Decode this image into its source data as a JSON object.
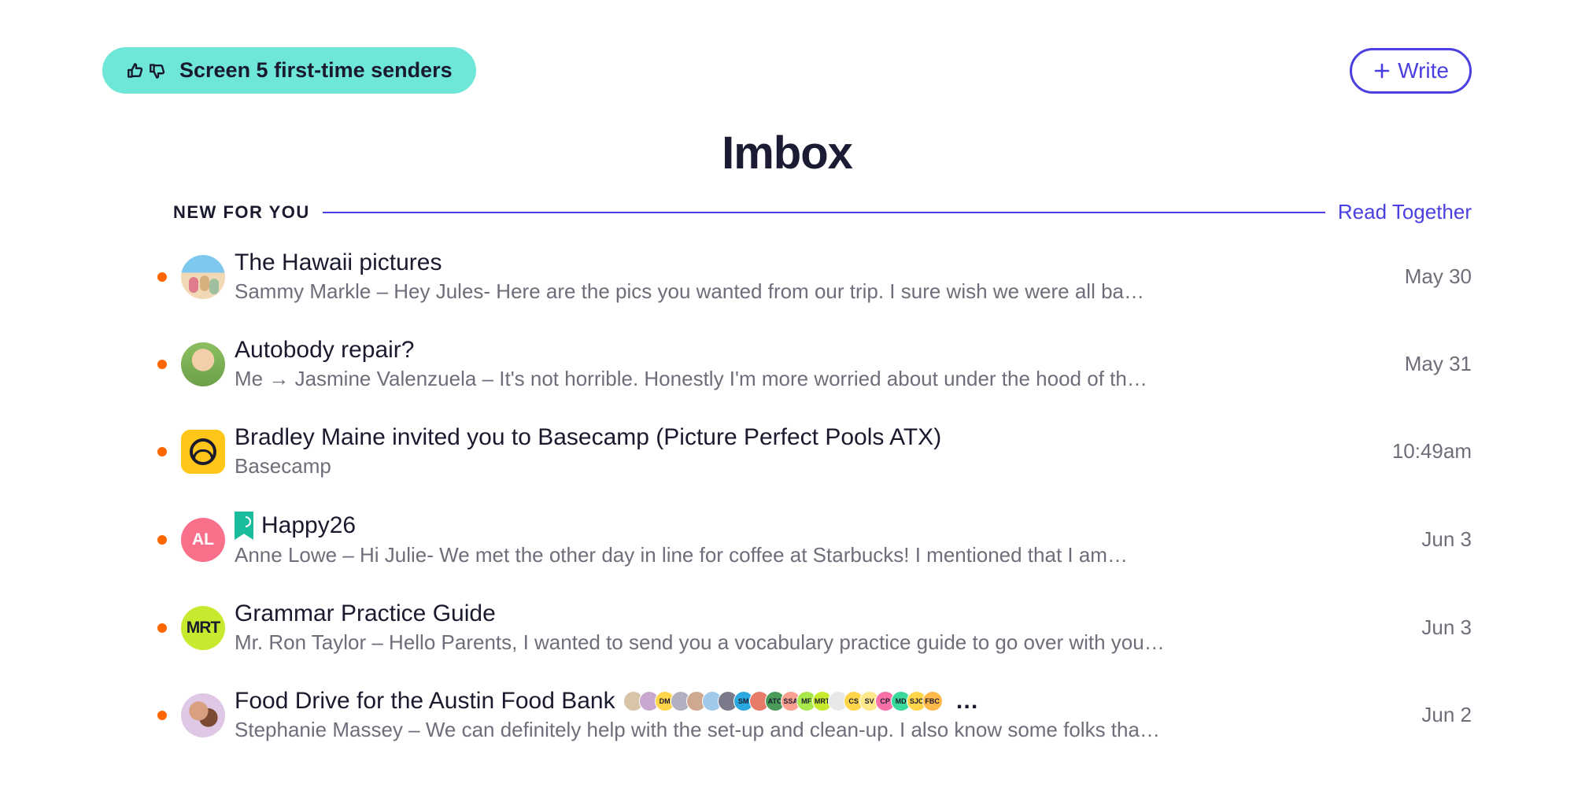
{
  "header": {
    "screener_label": "Screen 5 first-time senders",
    "write_label": "Write"
  },
  "title": "Imbox",
  "section": {
    "label": "NEW FOR YOU",
    "read_together": "Read Together"
  },
  "emails": [
    {
      "subject": "The Hawaii pictures",
      "sender_prefix": "Sammy Markle – ",
      "preview": "Hey Jules- Here are the pics you wanted from our trip. I sure wish we were all ba…",
      "date": "May 30",
      "avatar_type": "photo",
      "avatar_text": "",
      "has_bookmark": false,
      "has_thread_avatars": false
    },
    {
      "subject": "Autobody repair?",
      "sender_prefix": "Me → Jasmine Valenzuela – ",
      "preview": "It's not horrible. Honestly I'm more worried about under the hood of th…",
      "date": "May 31",
      "avatar_type": "photo",
      "avatar_text": "",
      "has_bookmark": false,
      "has_thread_avatars": false
    },
    {
      "subject": "Bradley Maine invited you to Basecamp (Picture Perfect Pools ATX)",
      "sender_prefix": "",
      "preview": "Basecamp",
      "date": "10:49am",
      "avatar_type": "basecamp",
      "avatar_text": "",
      "has_bookmark": false,
      "has_thread_avatars": false
    },
    {
      "subject": "Happy26",
      "sender_prefix": "Anne Lowe – ",
      "preview": "Hi Julie- We met the other day in line for coffee at Starbucks! I mentioned that I am…",
      "date": "Jun 3",
      "avatar_type": "initials",
      "avatar_text": "AL",
      "has_bookmark": true,
      "has_thread_avatars": false
    },
    {
      "subject": "Grammar Practice Guide",
      "sender_prefix": "Mr. Ron Taylor – ",
      "preview": "Hello Parents, I wanted to send you a vocabulary practice guide to go over with you…",
      "date": "Jun 3",
      "avatar_type": "initials",
      "avatar_text": "MRT",
      "has_bookmark": false,
      "has_thread_avatars": false
    },
    {
      "subject": "Food Drive for the Austin Food Bank",
      "sender_prefix": "Stephanie Massey – ",
      "preview": "We can definitely help with the set-up and clean-up. I also know some folks tha…",
      "date": "Jun 2",
      "avatar_type": "photo",
      "avatar_text": "",
      "has_bookmark": false,
      "has_thread_avatars": true
    }
  ],
  "thread_participants": [
    {
      "label": "",
      "bg": "#d8c4a8"
    },
    {
      "label": "",
      "bg": "#c9a8d0"
    },
    {
      "label": "DM",
      "bg": "#ffd54a"
    },
    {
      "label": "",
      "bg": "#b0b0c0"
    },
    {
      "label": "",
      "bg": "#d0a890"
    },
    {
      "label": "",
      "bg": "#a0c8e8"
    },
    {
      "label": "",
      "bg": "#7a7a8a"
    },
    {
      "label": "SM",
      "bg": "#2aa8e0"
    },
    {
      "label": "",
      "bg": "#e87a6a"
    },
    {
      "label": "ATC",
      "bg": "#4a9a5a"
    },
    {
      "label": "SSA",
      "bg": "#f9a090"
    },
    {
      "label": "MF",
      "bg": "#a8e84a"
    },
    {
      "label": "MRT",
      "bg": "#c7ea2e"
    },
    {
      "label": "",
      "bg": "#e8e8e8"
    },
    {
      "label": "CS",
      "bg": "#ffd54a"
    },
    {
      "label": "SV",
      "bg": "#ffe88a"
    },
    {
      "label": "CP",
      "bg": "#f970a8"
    },
    {
      "label": "MD",
      "bg": "#3ad89a"
    },
    {
      "label": "SJC",
      "bg": "#ffd54a"
    },
    {
      "label": "FBC",
      "bg": "#ffb84a"
    }
  ]
}
